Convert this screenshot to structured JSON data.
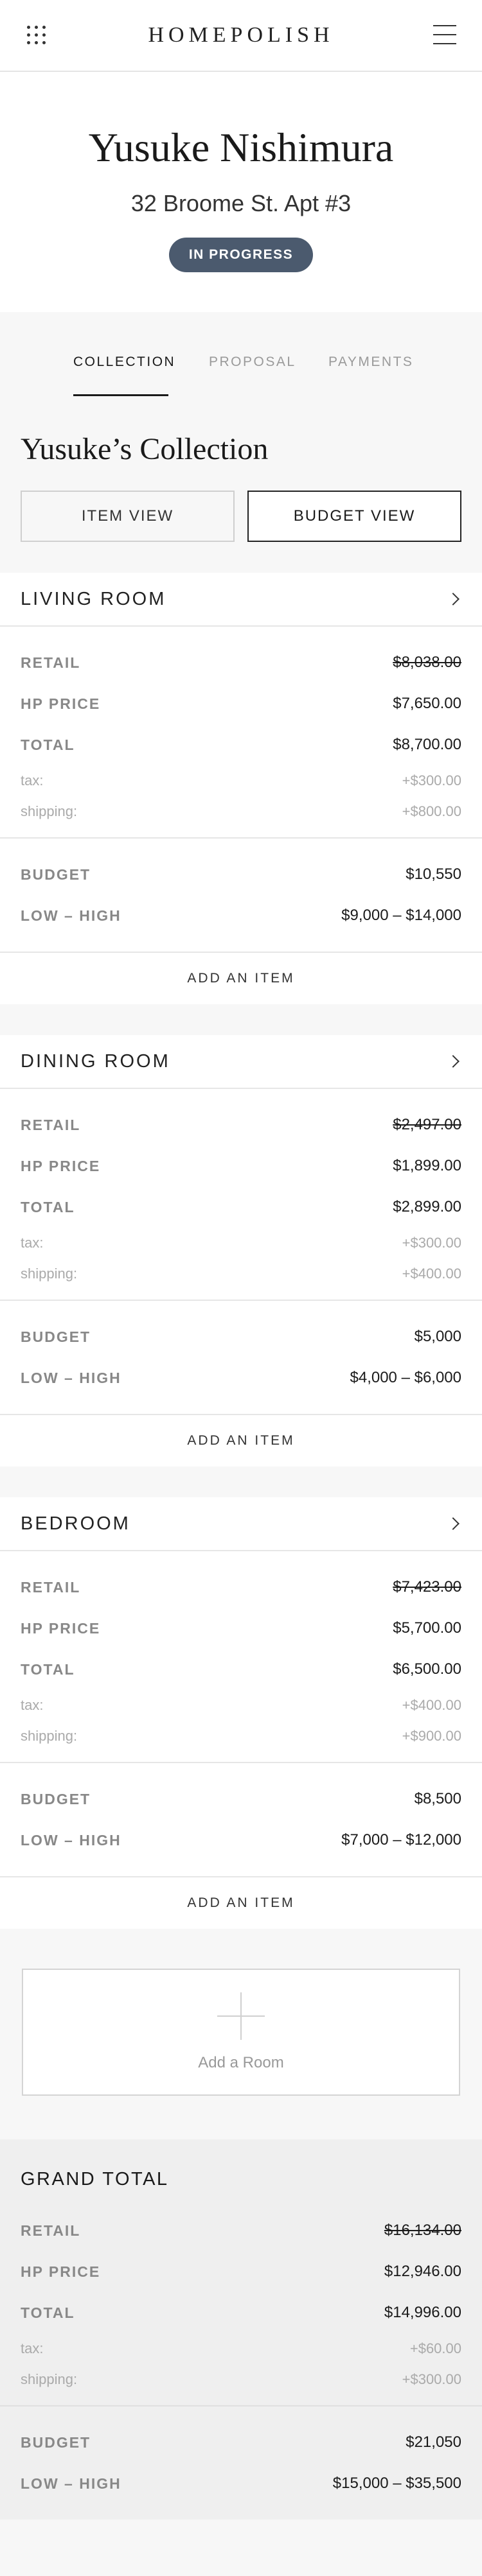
{
  "header": {
    "brand": "HOMEPOLISH",
    "grid_icon": "app-grid-icon",
    "menu_icon": "hamburger-menu-icon"
  },
  "project": {
    "client_name": "Yusuke Nishimura",
    "address": "32 Broome St. Apt #3",
    "status": "IN PROGRESS",
    "status_color": "#4b5a6e"
  },
  "tabs": [
    {
      "label": "COLLECTION",
      "active": true
    },
    {
      "label": "PROPOSAL",
      "active": false
    },
    {
      "label": "PAYMENTS",
      "active": false
    }
  ],
  "collection": {
    "title": "Yusuke’s Collection",
    "item_view_label": "ITEM VIEW",
    "budget_view_label": "BUDGET VIEW",
    "selected_view": "BUDGET VIEW"
  },
  "labels": {
    "retail": "RETAIL",
    "hp_price": "HP PRICE",
    "total": "TOTAL",
    "tax": "tax:",
    "shipping": "shipping:",
    "budget": "BUDGET",
    "low_high": "LOW – HIGH",
    "add_item": "ADD AN ITEM"
  },
  "rooms": [
    {
      "name": "LIVING ROOM",
      "retail": "$8,038.00",
      "hp_price": "$7,650.00",
      "total": "$8,700.00",
      "tax": "+$300.00",
      "shipping": "+$800.00",
      "budget": "$10,550",
      "low_high": "$9,000 – $14,000"
    },
    {
      "name": "DINING ROOM",
      "retail": "$2,497.00",
      "hp_price": "$1,899.00",
      "total": "$2,899.00",
      "tax": "+$300.00",
      "shipping": "+$400.00",
      "budget": "$5,000",
      "low_high": "$4,000 – $6,000"
    },
    {
      "name": "BEDROOM",
      "retail": "$7,423.00",
      "hp_price": "$5,700.00",
      "total": "$6,500.00",
      "tax": "+$400.00",
      "shipping": "+$900.00",
      "budget": "$8,500",
      "low_high": "$7,000 – $12,000"
    }
  ],
  "add_room": {
    "label": "Add a Room"
  },
  "grand_total": {
    "title": "GRAND TOTAL",
    "retail": "$16,134.00",
    "hp_price": "$12,946.00",
    "total": "$14,996.00",
    "tax": "+$60.00",
    "shipping": "+$300.00",
    "budget": "$21,050",
    "low_high": "$15,000 – $35,500"
  }
}
